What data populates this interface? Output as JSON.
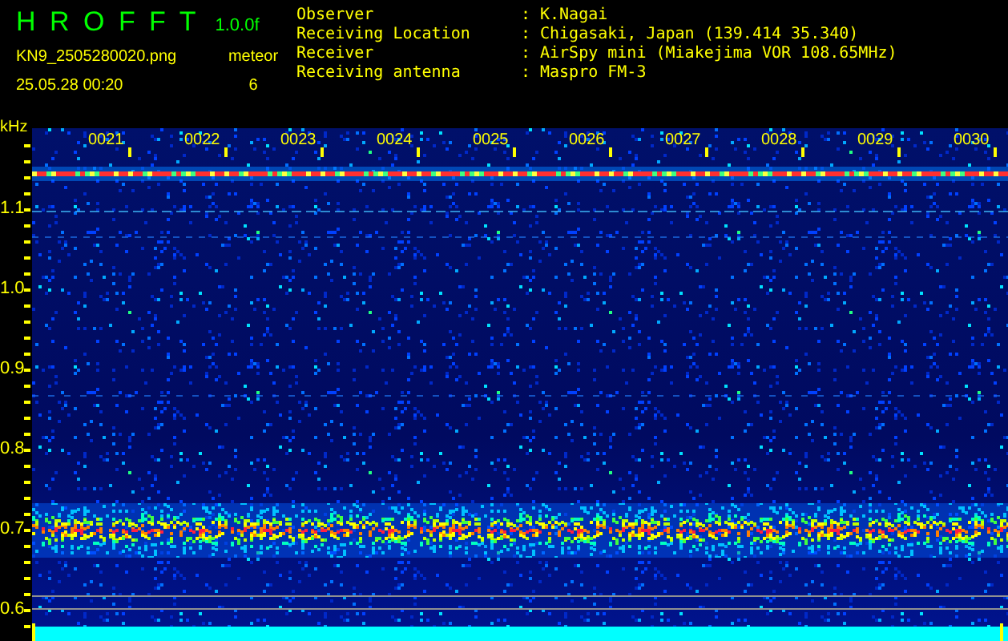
{
  "app": {
    "title": "H R O F F T",
    "version": "1.0.0f",
    "file": "KN9_2505280020.png",
    "datetime": "25.05.28 00:20",
    "count_label": "meteor",
    "count": "6"
  },
  "info": [
    {
      "label": "Observer",
      "sep": ":",
      "value": "K.Nagai"
    },
    {
      "label": "Receiving Location",
      "sep": ":",
      "value": "Chigasaki, Japan (139.414 35.340)"
    },
    {
      "label": "Receiver",
      "sep": ":",
      "value": "AirSpy mini (Miakejima VOR 108.65MHz)"
    },
    {
      "label": "Receiving antenna",
      "sep": ":",
      "value": "Maspro FM-3"
    }
  ],
  "spectrogram": {
    "y_unit": "kHz",
    "y_labels": [
      "1.1",
      "1.0",
      "0.9",
      "0.8",
      "0.7",
      "0.6"
    ],
    "time_labels": [
      "0021",
      "0022",
      "0023",
      "0024",
      "0025",
      "0026",
      "0027",
      "0028",
      "0029",
      "0030"
    ]
  }
}
